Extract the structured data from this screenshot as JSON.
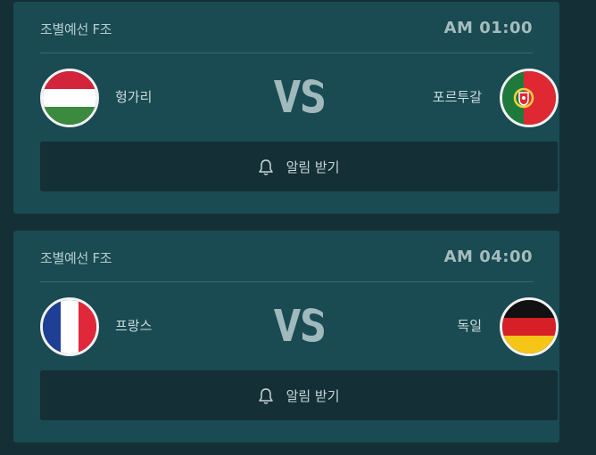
{
  "matches": [
    {
      "group": "조별예선 F조",
      "time": "AM 01:00",
      "home": {
        "name": "헝가리",
        "flag_icon": "hungary-flag-icon"
      },
      "away": {
        "name": "포르투갈",
        "flag_icon": "portugal-flag-icon"
      },
      "vs_label": "VS",
      "alarm_label": "알림 받기"
    },
    {
      "group": "조별예선 F조",
      "time": "AM 04:00",
      "home": {
        "name": "프랑스",
        "flag_icon": "france-flag-icon"
      },
      "away": {
        "name": "독일",
        "flag_icon": "germany-flag-icon"
      },
      "vs_label": "VS",
      "alarm_label": "알림 받기"
    }
  ],
  "colors": {
    "page_bg": "#143036",
    "card_bg": "#1a4a52",
    "button_bg": "#142f36",
    "vs_color": "#9fb9bc"
  }
}
